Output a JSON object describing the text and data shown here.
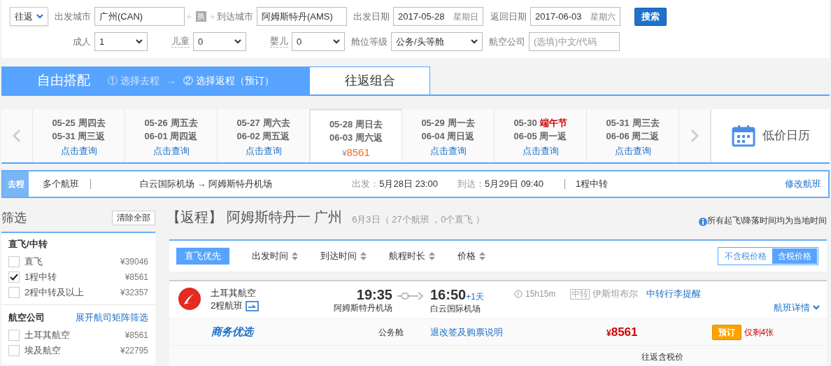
{
  "search": {
    "trip_type": "往返",
    "from_label": "出发城市",
    "from_value": "广州(CAN)",
    "swap": "换",
    "to_label": "到达城市",
    "to_value": "阿姆斯特丹(AMS)",
    "depart_label": "出发日期",
    "depart_date": "2017-05-28",
    "depart_weekday": "星期日",
    "return_label": "返回日期",
    "return_date": "2017-06-03",
    "return_weekday": "星期六",
    "search_button": "搜索",
    "passengers": [
      {
        "label": "成人",
        "value": "1",
        "hint": false
      },
      {
        "label": "儿童",
        "value": "0",
        "hint": true
      },
      {
        "label": "婴儿",
        "value": "0",
        "hint": true
      }
    ],
    "cabin_label": "舱位等级",
    "cabin_value": "公务/头等舱",
    "airline_label": "航空公司",
    "airline_placeholder": "(选填)中文/代码"
  },
  "mode": {
    "title": "自由搭配",
    "steps": [
      {
        "label": "① 选择去程",
        "selected": false
      },
      {
        "label": "② 选择返程（预订）",
        "selected": true
      }
    ],
    "arrow": "→",
    "tab": "往返组合"
  },
  "dates": [
    {
      "depart": "05-25",
      "depart_day": "周四去",
      "holiday": false,
      "return": "05-31 周三返",
      "action": "点击查询",
      "selected": false
    },
    {
      "depart": "05-26",
      "depart_day": "周五去",
      "holiday": false,
      "return": "06-01 周四返",
      "action": "点击查询",
      "selected": false
    },
    {
      "depart": "05-27",
      "depart_day": "周六去",
      "holiday": false,
      "return": "06-02 周五返",
      "action": "点击查询",
      "selected": false
    },
    {
      "depart": "05-28",
      "depart_day": "周日去",
      "holiday": false,
      "return": "06-03 周六返",
      "currency": "¥",
      "price": "8561",
      "selected": true
    },
    {
      "depart": "05-29",
      "depart_day": "周一去",
      "holiday": false,
      "return": "06-04 周日返",
      "action": "点击查询",
      "selected": false
    },
    {
      "depart": "05-30",
      "depart_day": "端午节",
      "holiday": true,
      "return": "06-05 周一返",
      "action": "点击查询",
      "selected": false
    },
    {
      "depart": "05-31",
      "depart_day": "周三去",
      "holiday": false,
      "return": "06-06 周二返",
      "action": "点击查询",
      "selected": false
    }
  ],
  "calendar": "低价日历",
  "outbound": {
    "tag": "去程",
    "flights": "多个航班",
    "route": "白云国际机场 → 阿姆斯特丹机场",
    "depart_label": "出发：",
    "depart_value": "5月28日 23:00",
    "arrive_label": "到达：",
    "arrive_value": "5月29日 09:40",
    "stops": "1程中转",
    "edit": "修改航班"
  },
  "filters": {
    "title": "筛选",
    "clear": "清除全部",
    "groups": [
      {
        "title": "直飞/中转",
        "options": [
          {
            "label": "直飞",
            "price": "¥39046",
            "checked": false
          },
          {
            "label": "1程中转",
            "price": "¥8561",
            "checked": true
          },
          {
            "label": "2程中转及以上",
            "price": "¥32357",
            "checked": false
          }
        ]
      },
      {
        "title": "航空公司",
        "link": "展开航司矩阵筛选",
        "options": [
          {
            "label": "土耳其航空",
            "price": "¥8561",
            "checked": false
          },
          {
            "label": "埃及航空",
            "price": "¥22795",
            "checked": false
          }
        ]
      }
    ]
  },
  "results": {
    "title": "【返程】 阿姆斯特丹一 广州",
    "summary": "6月3日（ 27个航班 ，0个直飞 ）",
    "note": "所有起飞\\降落时间均为当地时间",
    "sort": [
      {
        "label": "直飞优先",
        "kind": "toggle",
        "selected": true
      },
      {
        "label": "出发时间",
        "kind": "sort",
        "selected": false
      },
      {
        "label": "到达时间",
        "kind": "sort",
        "selected": false
      },
      {
        "label": "航程时长",
        "kind": "sort",
        "selected": false
      },
      {
        "label": "价格",
        "kind": "sort",
        "selected": false
      }
    ],
    "tax": [
      {
        "label": "不含税价格",
        "selected": false
      },
      {
        "label": "含税价格",
        "selected": true
      }
    ],
    "flight": {
      "airline": "土耳其航空",
      "legs": "2程航班",
      "depart_time": "19:35",
      "depart_airport": "阿姆斯特丹机场",
      "arrive_time": "16:50",
      "plus_day": "+1天",
      "arrive_airport": "白云国际机场",
      "duration": "15h15m",
      "transfer_tag": "中转",
      "transfer_city": "伊斯坦布尔",
      "baggage": "中转行李提醒",
      "details": "航班详情",
      "product": "商务优选",
      "cabin": "公务舱",
      "rules": "退改签及购票说明",
      "currency": "¥",
      "price": "8561",
      "book": "预订",
      "remaining": "仅剩4张",
      "price_note": "往返含税价"
    }
  }
}
